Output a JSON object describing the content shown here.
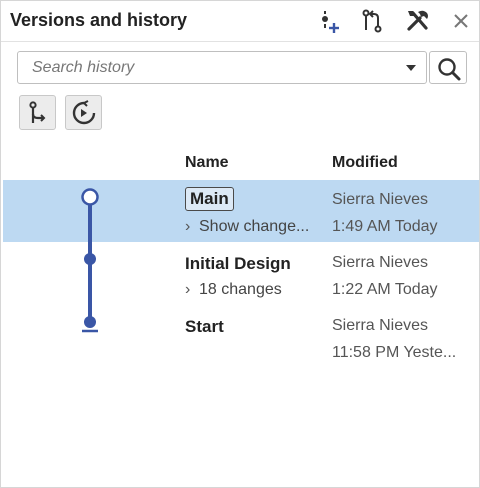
{
  "header": {
    "title": "Versions and history",
    "icons": [
      "create-version-icon",
      "compare-icon",
      "tools-icon",
      "close-icon"
    ]
  },
  "search": {
    "placeholder": "Search history",
    "value": ""
  },
  "toolbar": {
    "icons": [
      "branch-icon",
      "restore-icon"
    ]
  },
  "table": {
    "col_name": "Name",
    "col_modified": "Modified",
    "rows": [
      {
        "name": "Main",
        "sub": "Show change...",
        "author": "Sierra Nieves",
        "time": "1:49 AM Today",
        "selected": true
      },
      {
        "name": "Initial Design",
        "sub": "18 changes",
        "author": "Sierra Nieves",
        "time": "1:22 AM Today",
        "selected": false
      },
      {
        "name": "Start",
        "sub": "",
        "author": "Sierra Nieves",
        "time": "11:58 PM Yeste...",
        "selected": false
      }
    ]
  },
  "colors": {
    "graph_line": "#3a56a6",
    "selected_row": "#bdd9f2"
  }
}
